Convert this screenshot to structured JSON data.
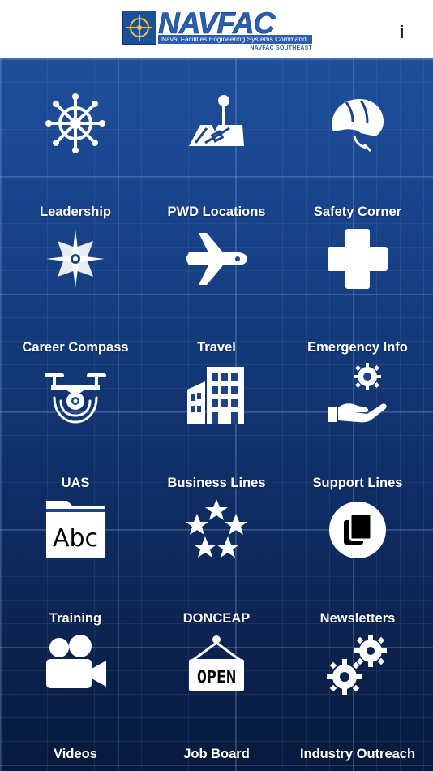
{
  "header": {
    "logo_word": "NAVFAC",
    "logo_subtitle": "Naval Facilities Engineering Systems Command",
    "logo_region": "NAVFAC SOUTHEAST",
    "info_label": "i"
  },
  "tiles": [
    {
      "label": "Leadership",
      "icon": "ship-wheel-icon"
    },
    {
      "label": "PWD Locations",
      "icon": "map-pin-icon"
    },
    {
      "label": "Safety Corner",
      "icon": "helmet-icon"
    },
    {
      "label": "Career Compass",
      "icon": "compass-star-icon"
    },
    {
      "label": "Travel",
      "icon": "airplane-icon"
    },
    {
      "label": "Emergency Info",
      "icon": "medical-cross-icon"
    },
    {
      "label": "UAS",
      "icon": "drone-icon"
    },
    {
      "label": "Business Lines",
      "icon": "buildings-icon"
    },
    {
      "label": "Support Lines",
      "icon": "hand-gear-icon"
    },
    {
      "label": "Training",
      "icon": "abc-book-icon"
    },
    {
      "label": "DONCEAP",
      "icon": "stars-icon"
    },
    {
      "label": "Newsletters",
      "icon": "documents-icon"
    },
    {
      "label": "Videos",
      "icon": "video-camera-icon"
    },
    {
      "label": "Job Board",
      "icon": "open-sign-icon"
    },
    {
      "label": "Industry Outreach",
      "icon": "gears-icon"
    }
  ],
  "colors": {
    "header_bg": "#ffffff",
    "brand_blue": "#2a5fb0",
    "grid_top": "#1f4f9c",
    "grid_bottom": "#081a3d",
    "label": "#ffffff"
  },
  "open_sign_text": "OPEN"
}
